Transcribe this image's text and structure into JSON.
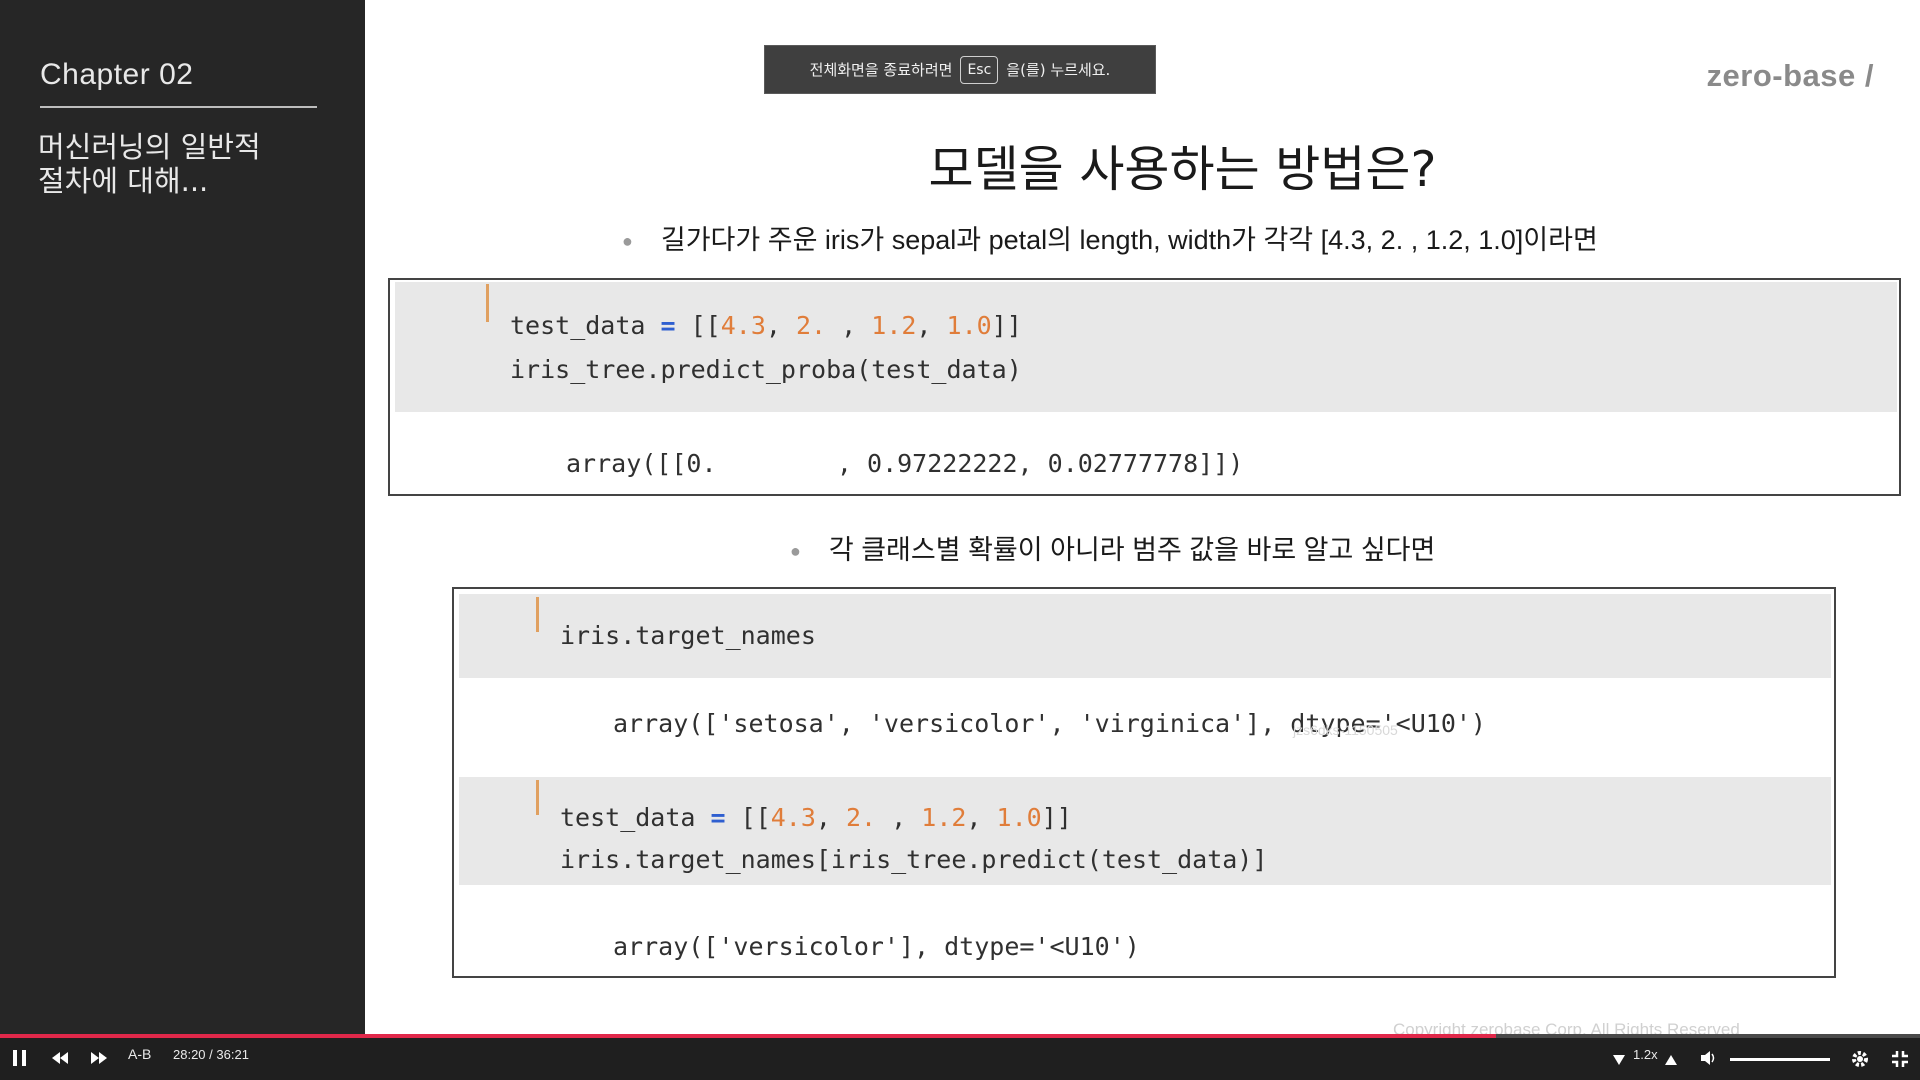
{
  "sidebar": {
    "chapter": "Chapter  02",
    "topic": "머신러닝의 일반적\n절차에 대해..."
  },
  "slide": {
    "logo": "zero-base /",
    "title": "모델을 사용하는 방법은?",
    "bullet1": "길가다가 주운 iris가 sepal과 petal의 length, width가 각각 [4.3, 2. , 1.2, 1.0]이라면",
    "bullet2": "각 클래스별 확률이 아니라 범주 값을 바로 알고 싶다면",
    "code1": {
      "line1_prefix": "test_data ",
      "line1_eq": "=",
      "line1_open": " [[",
      "n1": "4.3",
      "n2": "2. ",
      "n3": "1.2",
      "n4": "1.0",
      "line1_close": "]]",
      "comma": ", ",
      "line2": "iris_tree.predict_proba(test_data)",
      "output": "array([[0.        , 0.97222222, 0.02777778]])"
    },
    "code2": {
      "in1": "iris.target_names",
      "out1": "array(['setosa', 'versicolor', 'virginica'], dtype='<U10')",
      "in2_prefix": "test_data ",
      "in2_eq": "=",
      "in2_open": " [[",
      "n1": "4.3",
      "n2": "2. ",
      "n3": "1.2",
      "n4": "1.0",
      "in2_close": "]]",
      "comma": ", ",
      "in2_line2": "iris.target_names[iris_tree.predict(test_data)]",
      "out2": "array(['versicolor'], dtype='<U10')"
    },
    "watermark": "jzs6dks-1150505",
    "copyright": "Copyright zerobase Corp. All Rights Reserved"
  },
  "toast": {
    "before": "전체화면을 종료하려면",
    "key": "Esc",
    "after": "을(를) 누르세요."
  },
  "player": {
    "ab_label": "A-B",
    "current_time": "28:20",
    "separator": "/",
    "duration": "36:21",
    "speed": "1.2x",
    "progress": 0.779,
    "volume": 1.0,
    "icons": [
      "pause-icon",
      "rewind-icon",
      "fast-forward-icon",
      "speed-down-icon",
      "speed-up-icon",
      "volume-icon",
      "settings-icon",
      "exit-fullscreen-icon"
    ]
  }
}
